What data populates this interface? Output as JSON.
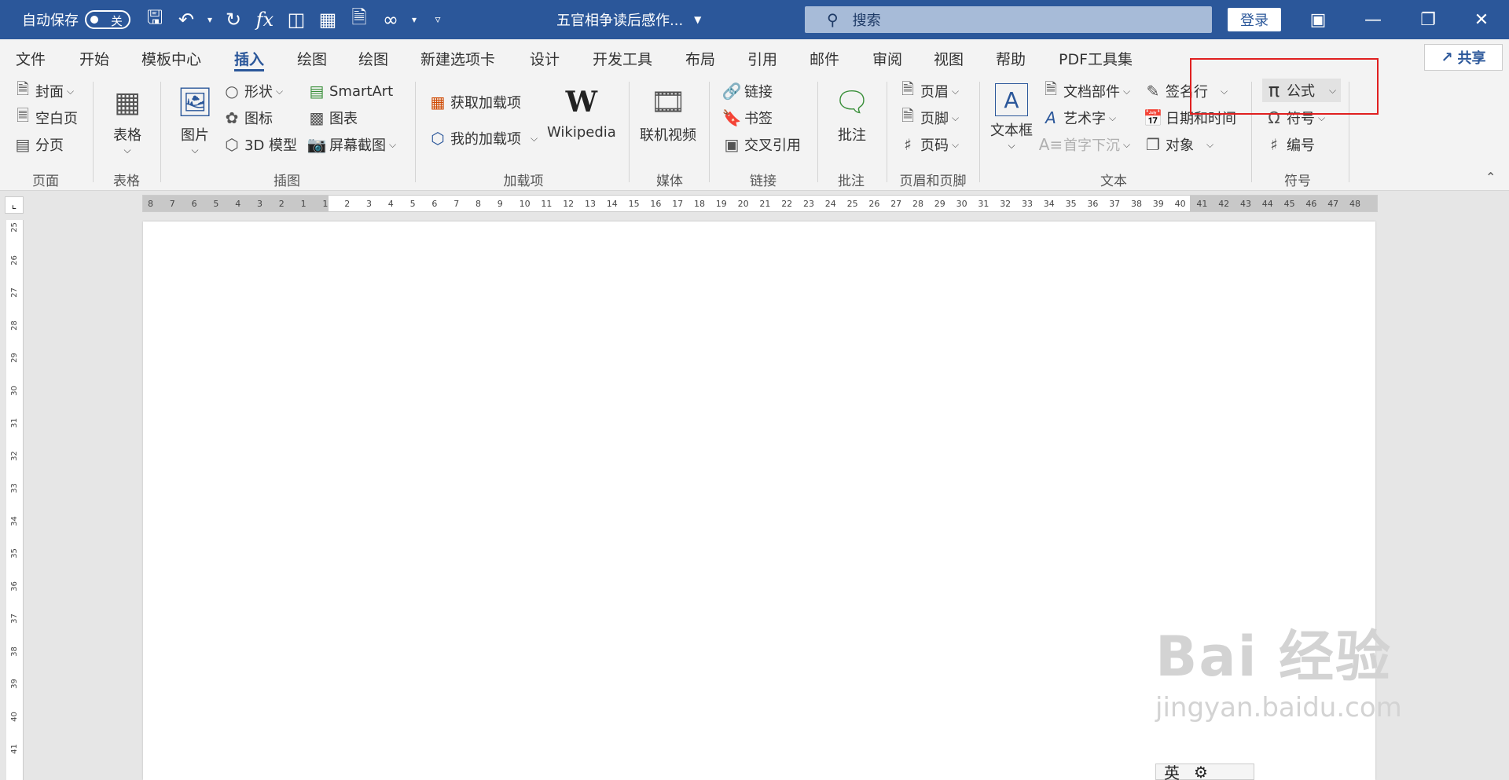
{
  "titlebar": {
    "autosave_label": "自动保存",
    "autosave_state": "关",
    "doc_title": "五官相争读后感作...",
    "search_placeholder": "搜索",
    "login_label": "登录"
  },
  "tabs": [
    {
      "label": "文件"
    },
    {
      "label": "开始"
    },
    {
      "label": "模板中心"
    },
    {
      "label": "插入",
      "active": true
    },
    {
      "label": "绘图"
    },
    {
      "label": "绘图"
    },
    {
      "label": "新建选项卡"
    },
    {
      "label": "设计"
    },
    {
      "label": "开发工具"
    },
    {
      "label": "布局"
    },
    {
      "label": "引用"
    },
    {
      "label": "邮件"
    },
    {
      "label": "审阅"
    },
    {
      "label": "视图"
    },
    {
      "label": "帮助"
    },
    {
      "label": "PDF工具集"
    }
  ],
  "share_label": "共享",
  "ribbon": {
    "page": {
      "group": "页面",
      "cover": "封面",
      "blank": "空白页",
      "break": "分页"
    },
    "table": {
      "group": "表格",
      "table": "表格"
    },
    "illustrations": {
      "group": "插图",
      "picture": "图片",
      "shapes": "形状",
      "icons": "图标",
      "model3d": "3D 模型",
      "smartart": "SmartArt",
      "chart": "图表",
      "screenshot": "屏幕截图"
    },
    "addins": {
      "group": "加载项",
      "get": "获取加载项",
      "my": "我的加载项",
      "wikipedia": "Wikipedia"
    },
    "media": {
      "group": "媒体",
      "video": "联机视频"
    },
    "links": {
      "group": "链接",
      "link": "链接",
      "bookmark": "书签",
      "crossref": "交叉引用"
    },
    "comments": {
      "group": "批注",
      "comment": "批注"
    },
    "headerfooter": {
      "group": "页眉和页脚",
      "header": "页眉",
      "footer": "页脚",
      "pagenum": "页码"
    },
    "text": {
      "group": "文本",
      "textbox": "文本框",
      "quickparts": "文档部件",
      "wordart": "艺术字",
      "dropcap": "首字下沉",
      "signature": "签名行",
      "datetime": "日期和时间",
      "object": "对象"
    },
    "symbols": {
      "group": "符号",
      "equation": "公式",
      "symbol": "符号",
      "number": "编号"
    }
  },
  "ruler_h": [
    "8",
    "7",
    "6",
    "5",
    "4",
    "3",
    "2",
    "1",
    "1",
    "2",
    "3",
    "4",
    "5",
    "6",
    "7",
    "8",
    "9",
    "10",
    "11",
    "12",
    "13",
    "14",
    "15",
    "16",
    "17",
    "18",
    "19",
    "20",
    "21",
    "22",
    "23",
    "24",
    "25",
    "26",
    "27",
    "28",
    "29",
    "30",
    "31",
    "32",
    "33",
    "34",
    "35",
    "36",
    "37",
    "38",
    "39",
    "40",
    "41",
    "42",
    "43",
    "44",
    "45",
    "46",
    "47",
    "48"
  ],
  "ruler_v": [
    "25",
    "26",
    "27",
    "28",
    "29",
    "30",
    "31",
    "32",
    "33",
    "34",
    "35",
    "36",
    "37",
    "38",
    "39",
    "40",
    "41"
  ],
  "watermark": {
    "brand": "Bai 经验",
    "url": "jingyan.baidu.com"
  },
  "ime": {
    "lang": "英",
    "gear": "⚙"
  }
}
